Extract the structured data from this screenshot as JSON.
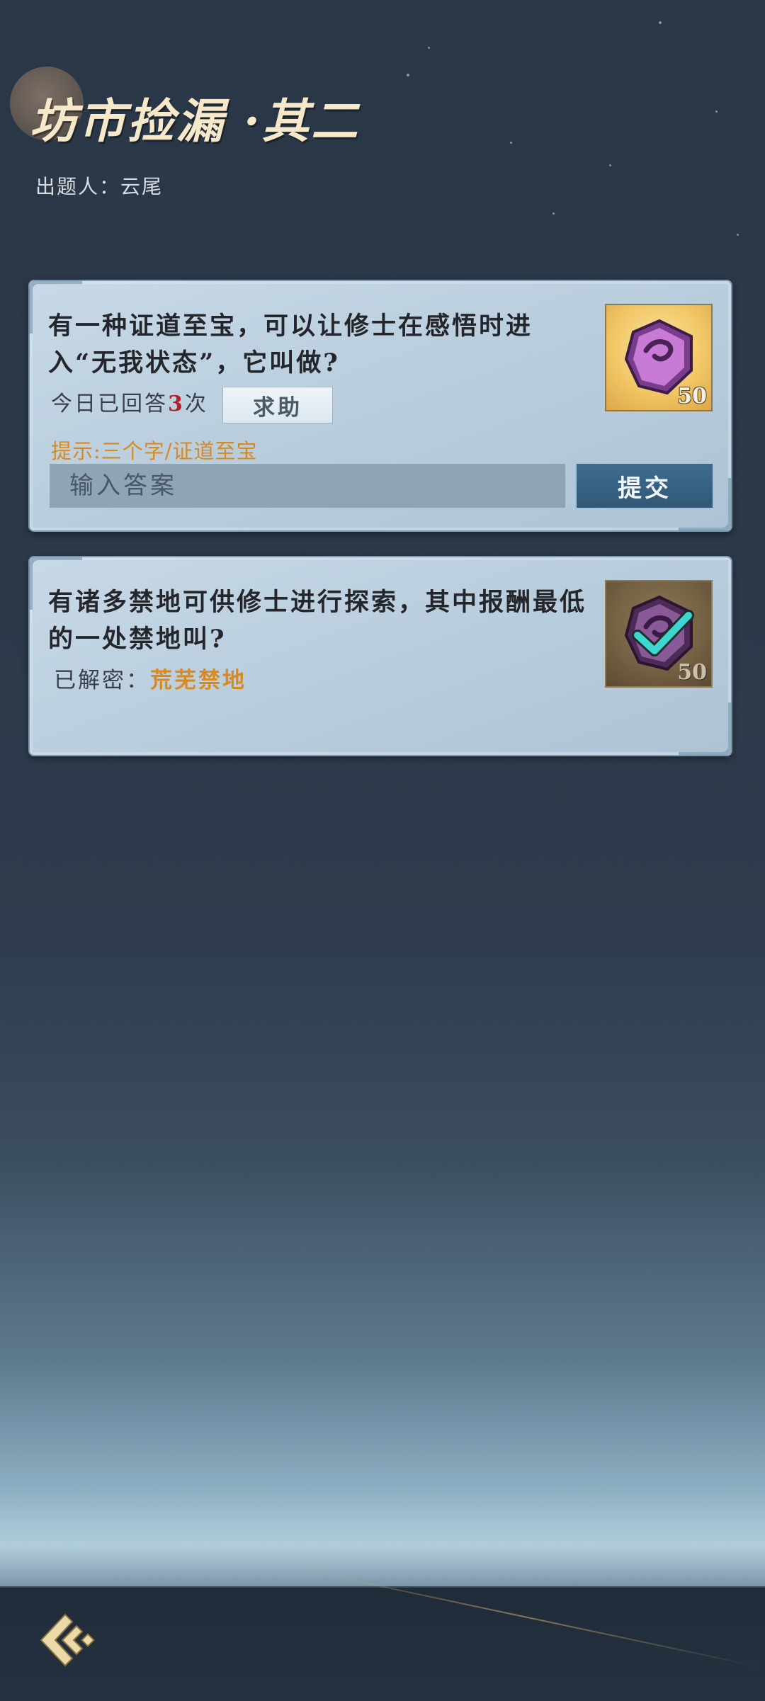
{
  "header": {
    "title": "坊市捡漏 ·其二",
    "author": "出题人：云尾"
  },
  "questions": [
    {
      "text": "有一种证道至宝，可以让修士在感悟时进入“无我状态”，它叫做?",
      "answered_prefix": "今日已回答",
      "answered_count": "3",
      "answered_suffix": "次",
      "help_label": "求助",
      "hint": "提示:三个字/证道至宝",
      "input_placeholder": "输入答案",
      "input_value": "",
      "submit_label": "提交",
      "reward_count": "50",
      "reward_icon": "purple-token-icon",
      "status": "open"
    },
    {
      "text": "有诸多禁地可供修士进行探索，其中报酬最低的一处禁地叫?",
      "solved_label": "已解密：",
      "solved_answer": "荒芜禁地",
      "reward_count": "50",
      "reward_icon": "purple-token-checked-icon",
      "status": "solved"
    }
  ],
  "footer": {
    "back_icon": "back-arrow-icon"
  },
  "colors": {
    "hint": "#d98a1f",
    "answer_count": "#b3202c",
    "submit_button": "#3f6c8e"
  }
}
